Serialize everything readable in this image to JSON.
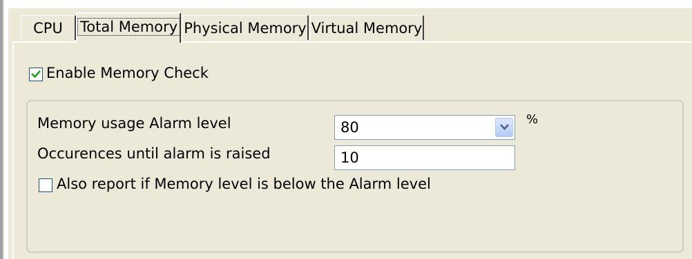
{
  "tabs": [
    {
      "label": "CPU"
    },
    {
      "label": "Total Memory"
    },
    {
      "label": "Physical Memory"
    },
    {
      "label": "Virtual Memory"
    }
  ],
  "active_tab": "Total Memory",
  "enable_check": {
    "label": "Enable Memory Check",
    "checked": true
  },
  "alarm_level": {
    "label": "Memory usage Alarm level",
    "value": "80",
    "unit": "%"
  },
  "occurrences": {
    "label": "Occurences until alarm is raised",
    "value": "10"
  },
  "report_below": {
    "label": "Also report if Memory level is below the Alarm level",
    "checked": false
  },
  "colors": {
    "panel_bg": "#ece9d8",
    "checkbox_border": "#1c5180",
    "checkmark": "#21a121",
    "field_border": "#7f9db9",
    "dropdown_arrow": "#4d6185"
  },
  "icons": {
    "checkmark": "checkmark-icon",
    "dropdown_arrow": "chevron-down-icon"
  }
}
